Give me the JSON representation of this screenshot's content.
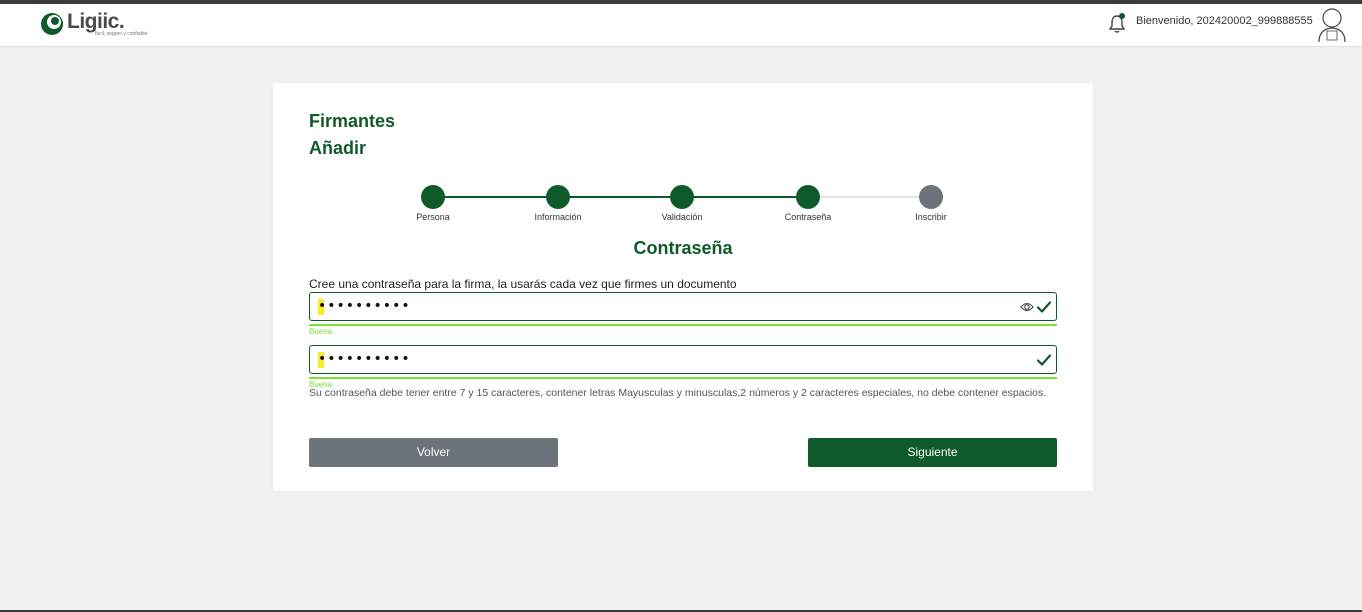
{
  "header": {
    "logo_text": "Ligiic.",
    "logo_tagline": "fácil, seguro y confiable",
    "welcome_text": "Bienvenido, 202420002_999888555"
  },
  "card": {
    "title": "Firmantes",
    "subtitle": "Añadir"
  },
  "stepper": {
    "steps": [
      {
        "label": "Persona",
        "status": "done"
      },
      {
        "label": "Información",
        "status": "done"
      },
      {
        "label": "Validación",
        "status": "done"
      },
      {
        "label": "Contraseña",
        "status": "current"
      },
      {
        "label": "Inscribir",
        "status": "pending"
      }
    ]
  },
  "form": {
    "section_title": "Contraseña",
    "instruction": "Cree una contraseña para la firma, la usarás cada vez que firmes un documento",
    "password": {
      "value": "••••••••••",
      "strength": "Buena"
    },
    "confirm": {
      "value": "••••••••••",
      "strength": "Buena"
    },
    "hint": "Su contraseña debe tener entre 7 y 15 caracteres, contener letras Mayusculas y minusculas,2 números y 2 caracteres especiales, no debe contener espacios."
  },
  "buttons": {
    "back_label": "Volver",
    "next_label": "Siguiente"
  },
  "colors": {
    "primary": "#0f5a2a",
    "pending": "#6d737a",
    "strength": "#7be038",
    "highlight": "#f5ef2a"
  },
  "icons": [
    "bell-icon",
    "avatar-icon",
    "eye-icon",
    "check-icon"
  ]
}
